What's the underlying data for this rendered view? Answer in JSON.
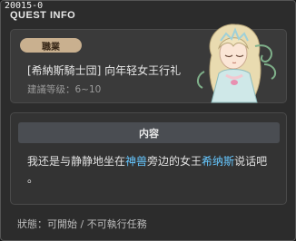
{
  "window": {
    "quest_id": "20015-0",
    "title": "QUEST INFO"
  },
  "info": {
    "job_badge": "職業",
    "quest_name": "[希納斯騎士団] 向年轻女王行礼",
    "recommend_level": "建議等级：6~10"
  },
  "content": {
    "header": "内容",
    "text_part1": "我还是与静静地坐在",
    "text_highlight1": "神兽",
    "text_part2": "旁边的女王",
    "text_highlight2": "希纳斯",
    "text_part3": "说话吧",
    "text_part4": "。"
  },
  "status": {
    "text": "狀態：可開始 / 不可執行任務"
  },
  "colors": {
    "highlight": "#66c7ff",
    "badge": "#c9b08f"
  }
}
